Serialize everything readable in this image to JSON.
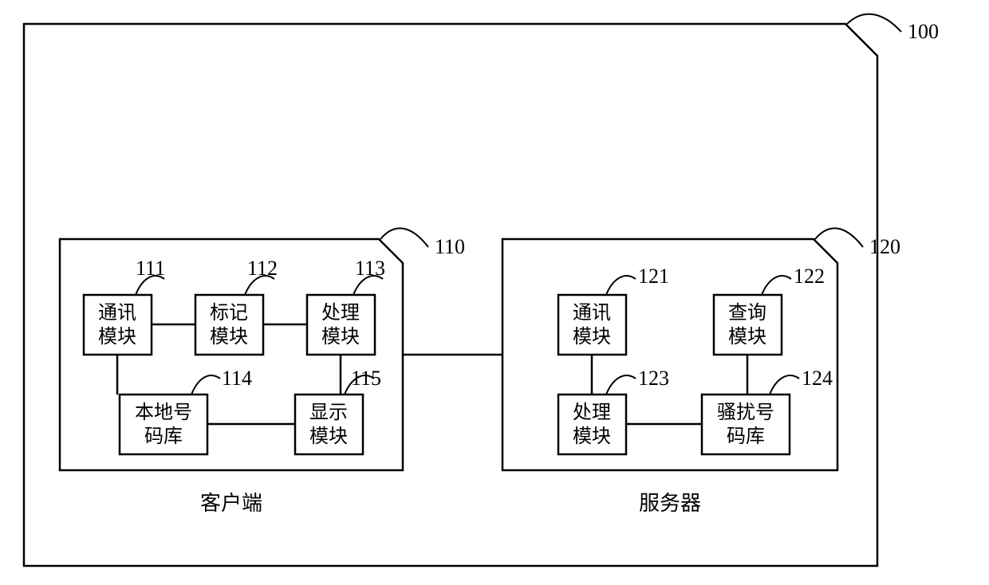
{
  "system": {
    "ref": "100",
    "client": {
      "ref": "110",
      "label": "客户端",
      "modules": {
        "comm": {
          "ref": "111",
          "l1": "通讯",
          "l2": "模块"
        },
        "mark": {
          "ref": "112",
          "l1": "标记",
          "l2": "模块"
        },
        "proc": {
          "ref": "113",
          "l1": "处理",
          "l2": "模块"
        },
        "localdb": {
          "ref": "114",
          "l1": "本地号",
          "l2": "码库"
        },
        "display": {
          "ref": "115",
          "l1": "显示",
          "l2": "模块"
        }
      }
    },
    "server": {
      "ref": "120",
      "label": "服务器",
      "modules": {
        "comm": {
          "ref": "121",
          "l1": "通讯",
          "l2": "模块"
        },
        "query": {
          "ref": "122",
          "l1": "查询",
          "l2": "模块"
        },
        "proc": {
          "ref": "123",
          "l1": "处理",
          "l2": "模块"
        },
        "spamdb": {
          "ref": "124",
          "l1": "骚扰号",
          "l2": "码库"
        }
      }
    }
  }
}
